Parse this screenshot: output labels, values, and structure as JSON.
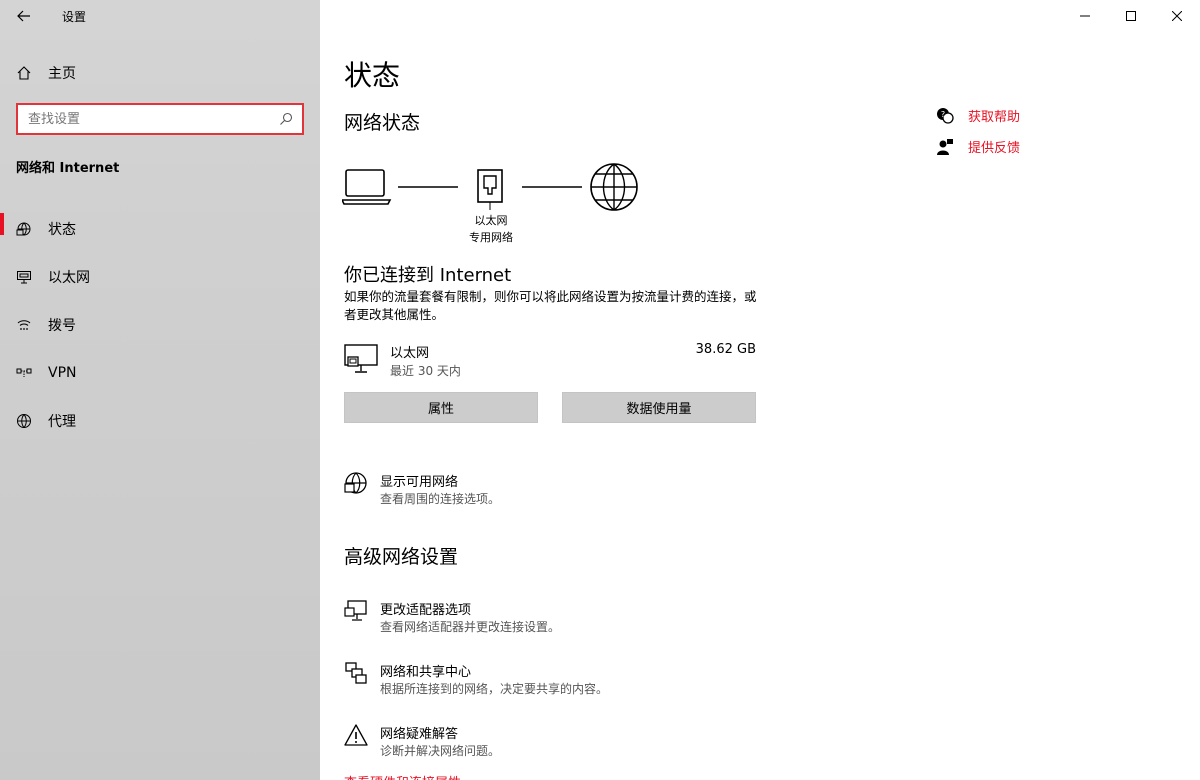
{
  "app": {
    "title": "设置"
  },
  "sidebar": {
    "home_label": "主页",
    "search_placeholder": "查找设置",
    "section": "网络和 Internet",
    "items": [
      {
        "label": "状态",
        "icon": "status-icon",
        "active": true
      },
      {
        "label": "以太网",
        "icon": "ethernet-icon",
        "active": false
      },
      {
        "label": "拨号",
        "icon": "dialup-icon",
        "active": false
      },
      {
        "label": "VPN",
        "icon": "vpn-icon",
        "active": false
      },
      {
        "label": "代理",
        "icon": "proxy-icon",
        "active": false
      }
    ]
  },
  "main": {
    "title": "状态",
    "network_status": "网络状态",
    "diagram": {
      "label1": "以太网",
      "label2": "专用网络"
    },
    "connected_title": "你已连接到 Internet",
    "connected_desc": "如果你的流量套餐有限制，则你可以将此网络设置为按流量计费的连接，或者更改其他属性。",
    "adapter": {
      "name": "以太网",
      "sub": "最近 30 天内",
      "size": "38.62 GB"
    },
    "buttons": {
      "properties": "属性",
      "data_usage": "数据使用量"
    },
    "show_networks": {
      "title": "显示可用网络",
      "sub": "查看周围的连接选项。"
    },
    "advanced_title": "高级网络设置",
    "advanced_items": [
      {
        "title": "更改适配器选项",
        "sub": "查看网络适配器并更改连接设置。",
        "icon": "adapter-icon"
      },
      {
        "title": "网络和共享中心",
        "sub": "根据所连接到的网络，决定要共享的内容。",
        "icon": "sharing-center-icon"
      },
      {
        "title": "网络疑难解答",
        "sub": "诊断并解决网络问题。",
        "icon": "warning-icon"
      }
    ],
    "cut_link": "查看硬件和连接属性"
  },
  "help": {
    "get_help": "获取帮助",
    "feedback": "提供反馈"
  },
  "colors": {
    "accent": "#e81123",
    "sidebar_bg": "#cfcfcf",
    "search_border": "#e0363b"
  }
}
